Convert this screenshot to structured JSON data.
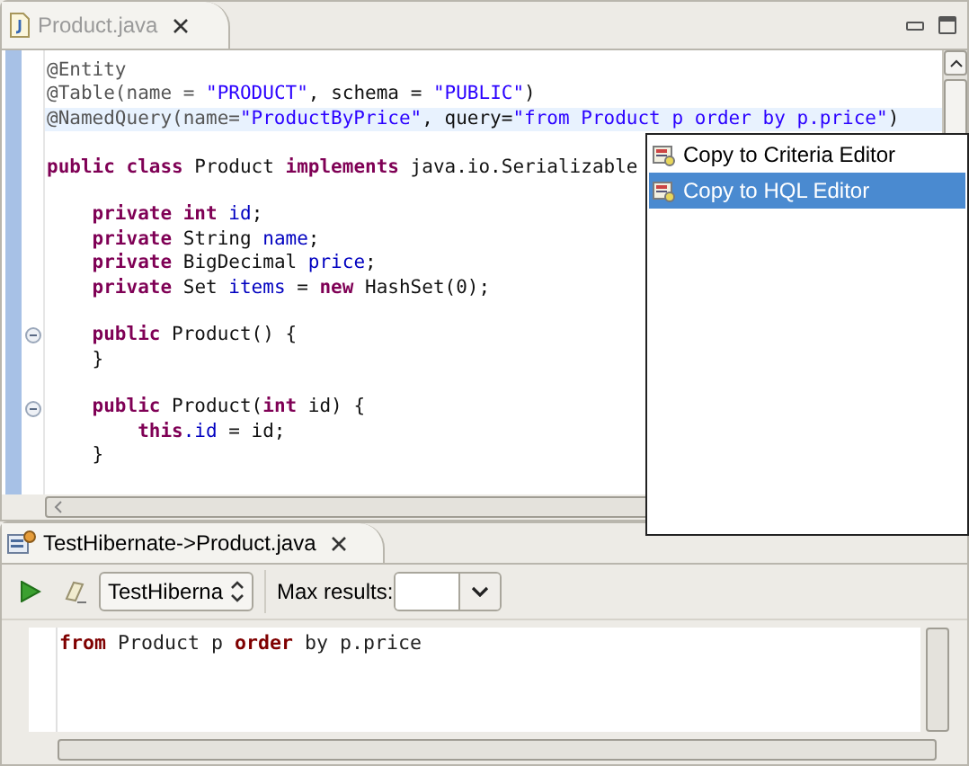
{
  "editor": {
    "tab": {
      "label": "Product.java",
      "selected": false
    },
    "lines": [
      {
        "kind": "code",
        "highlighted": false,
        "fold": false,
        "tokens": [
          {
            "kind": "annotation",
            "text": "@Entity"
          }
        ]
      },
      {
        "kind": "code",
        "highlighted": false,
        "fold": false,
        "tokens": [
          {
            "kind": "annotation",
            "text": "@Table(name = "
          },
          {
            "kind": "string",
            "text": "\"PRODUCT\""
          },
          {
            "kind": "plain",
            "text": ", schema = "
          },
          {
            "kind": "string",
            "text": "\"PUBLIC\""
          },
          {
            "kind": "plain",
            "text": ")"
          }
        ]
      },
      {
        "kind": "code",
        "highlighted": true,
        "fold": false,
        "tokens": [
          {
            "kind": "annotation",
            "text": "@NamedQuery(name="
          },
          {
            "kind": "string",
            "text": "\"ProductByPrice\""
          },
          {
            "kind": "plain",
            "text": ", query="
          },
          {
            "kind": "string",
            "text": "\"from Product p order by p.price\""
          },
          {
            "kind": "plain",
            "text": ")"
          }
        ]
      },
      {
        "kind": "blank"
      },
      {
        "kind": "code",
        "highlighted": false,
        "fold": false,
        "tokens": [
          {
            "kind": "keyword",
            "text": "public class"
          },
          {
            "kind": "plain",
            "text": " Product "
          },
          {
            "kind": "keyword",
            "text": "implements"
          },
          {
            "kind": "plain",
            "text": " java.io.Serializable"
          }
        ]
      },
      {
        "kind": "blank"
      },
      {
        "kind": "code",
        "highlighted": false,
        "fold": false,
        "tokens": [
          {
            "kind": "keyword",
            "text": "    private int "
          },
          {
            "kind": "field",
            "text": "id"
          },
          {
            "kind": "plain",
            "text": ";"
          }
        ]
      },
      {
        "kind": "code",
        "highlighted": false,
        "fold": false,
        "tokens": [
          {
            "kind": "keyword",
            "text": "    private"
          },
          {
            "kind": "plain",
            "text": " String "
          },
          {
            "kind": "field",
            "text": "name"
          },
          {
            "kind": "plain",
            "text": ";"
          }
        ]
      },
      {
        "kind": "code",
        "highlighted": false,
        "fold": false,
        "tokens": [
          {
            "kind": "keyword",
            "text": "    private"
          },
          {
            "kind": "plain",
            "text": " BigDecimal "
          },
          {
            "kind": "field",
            "text": "price"
          },
          {
            "kind": "plain",
            "text": ";"
          }
        ]
      },
      {
        "kind": "code",
        "highlighted": false,
        "fold": false,
        "tokens": [
          {
            "kind": "keyword",
            "text": "    private"
          },
          {
            "kind": "plain",
            "text": " Set "
          },
          {
            "kind": "field",
            "text": "items"
          },
          {
            "kind": "plain",
            "text": " = "
          },
          {
            "kind": "keyword",
            "text": "new"
          },
          {
            "kind": "plain",
            "text": " HashSet(0);"
          }
        ]
      },
      {
        "kind": "blank"
      },
      {
        "kind": "code",
        "highlighted": false,
        "fold": true,
        "tokens": [
          {
            "kind": "keyword",
            "text": "    public"
          },
          {
            "kind": "plain",
            "text": " Product() {"
          }
        ]
      },
      {
        "kind": "code",
        "highlighted": false,
        "fold": false,
        "tokens": [
          {
            "kind": "plain",
            "text": "    }"
          }
        ]
      },
      {
        "kind": "blank"
      },
      {
        "kind": "code",
        "highlighted": false,
        "fold": true,
        "tokens": [
          {
            "kind": "keyword",
            "text": "    public"
          },
          {
            "kind": "plain",
            "text": " Product("
          },
          {
            "kind": "keyword",
            "text": "int"
          },
          {
            "kind": "plain",
            "text": " id) {"
          }
        ]
      },
      {
        "kind": "code",
        "highlighted": false,
        "fold": false,
        "tokens": [
          {
            "kind": "keyword",
            "text": "        this"
          },
          {
            "kind": "field",
            "text": ".id"
          },
          {
            "kind": "plain",
            "text": " = id;"
          }
        ]
      },
      {
        "kind": "code",
        "highlighted": false,
        "fold": false,
        "tokens": [
          {
            "kind": "plain",
            "text": "    }"
          }
        ]
      }
    ]
  },
  "context_menu": {
    "items": [
      {
        "label": "Copy to Criteria Editor",
        "selected": false
      },
      {
        "label": "Copy to HQL Editor",
        "selected": true
      }
    ]
  },
  "hql_editor": {
    "tab": {
      "label": "TestHibernate->Product.java",
      "selected": true
    },
    "configuration": "TestHiberna",
    "max_results_label": "Max results:",
    "query": [
      {
        "kind": "keyword",
        "text": "from"
      },
      {
        "kind": "plain",
        "text": " Product p "
      },
      {
        "kind": "keyword",
        "text": "order"
      },
      {
        "kind": "plain",
        "text": " by p.price"
      }
    ]
  }
}
